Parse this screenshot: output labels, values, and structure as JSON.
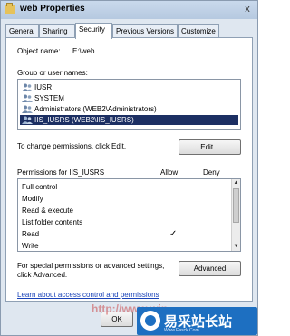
{
  "window": {
    "title": "web Properties",
    "close_glyph": "x"
  },
  "tabs": [
    {
      "label": "General"
    },
    {
      "label": "Sharing"
    },
    {
      "label": "Security"
    },
    {
      "label": "Previous Versions"
    },
    {
      "label": "Customize"
    }
  ],
  "security": {
    "object_name_label": "Object name:",
    "object_name_value": "E:\\web",
    "groups_label": "Group or user names:",
    "groups": [
      {
        "label": "IUSR"
      },
      {
        "label": "SYSTEM"
      },
      {
        "label": "Administrators (WEB2\\Administrators)"
      },
      {
        "label": "IIS_IUSRS (WEB2\\IIS_IUSRS)"
      }
    ],
    "selected_group_index": 3,
    "change_text": "To change permissions, click Edit.",
    "edit_button": "Edit...",
    "perm_header": "Permissions for IIS_IUSRS",
    "allow_header": "Allow",
    "deny_header": "Deny",
    "permissions": [
      {
        "label": "Full control",
        "allow": ""
      },
      {
        "label": "Modify",
        "allow": ""
      },
      {
        "label": "Read & execute",
        "allow": ""
      },
      {
        "label": "List folder contents",
        "allow": ""
      },
      {
        "label": "Read",
        "allow": "✓"
      },
      {
        "label": "Write",
        "allow": ""
      }
    ],
    "special_text_line1": "For special permissions or advanced settings,",
    "special_text_line2": "click Advanced.",
    "advanced_button": "Advanced",
    "learn_link": "Learn about access control and permissions"
  },
  "footer": {
    "ok_button": "OK"
  },
  "watermark": {
    "text": "易采站长站",
    "sub": "Www.Easck.Com",
    "stamp": "http://www.win..."
  },
  "colors": {
    "selection": "#1c2f63",
    "link": "#1a43b8",
    "accent": "#1d6fc1"
  }
}
